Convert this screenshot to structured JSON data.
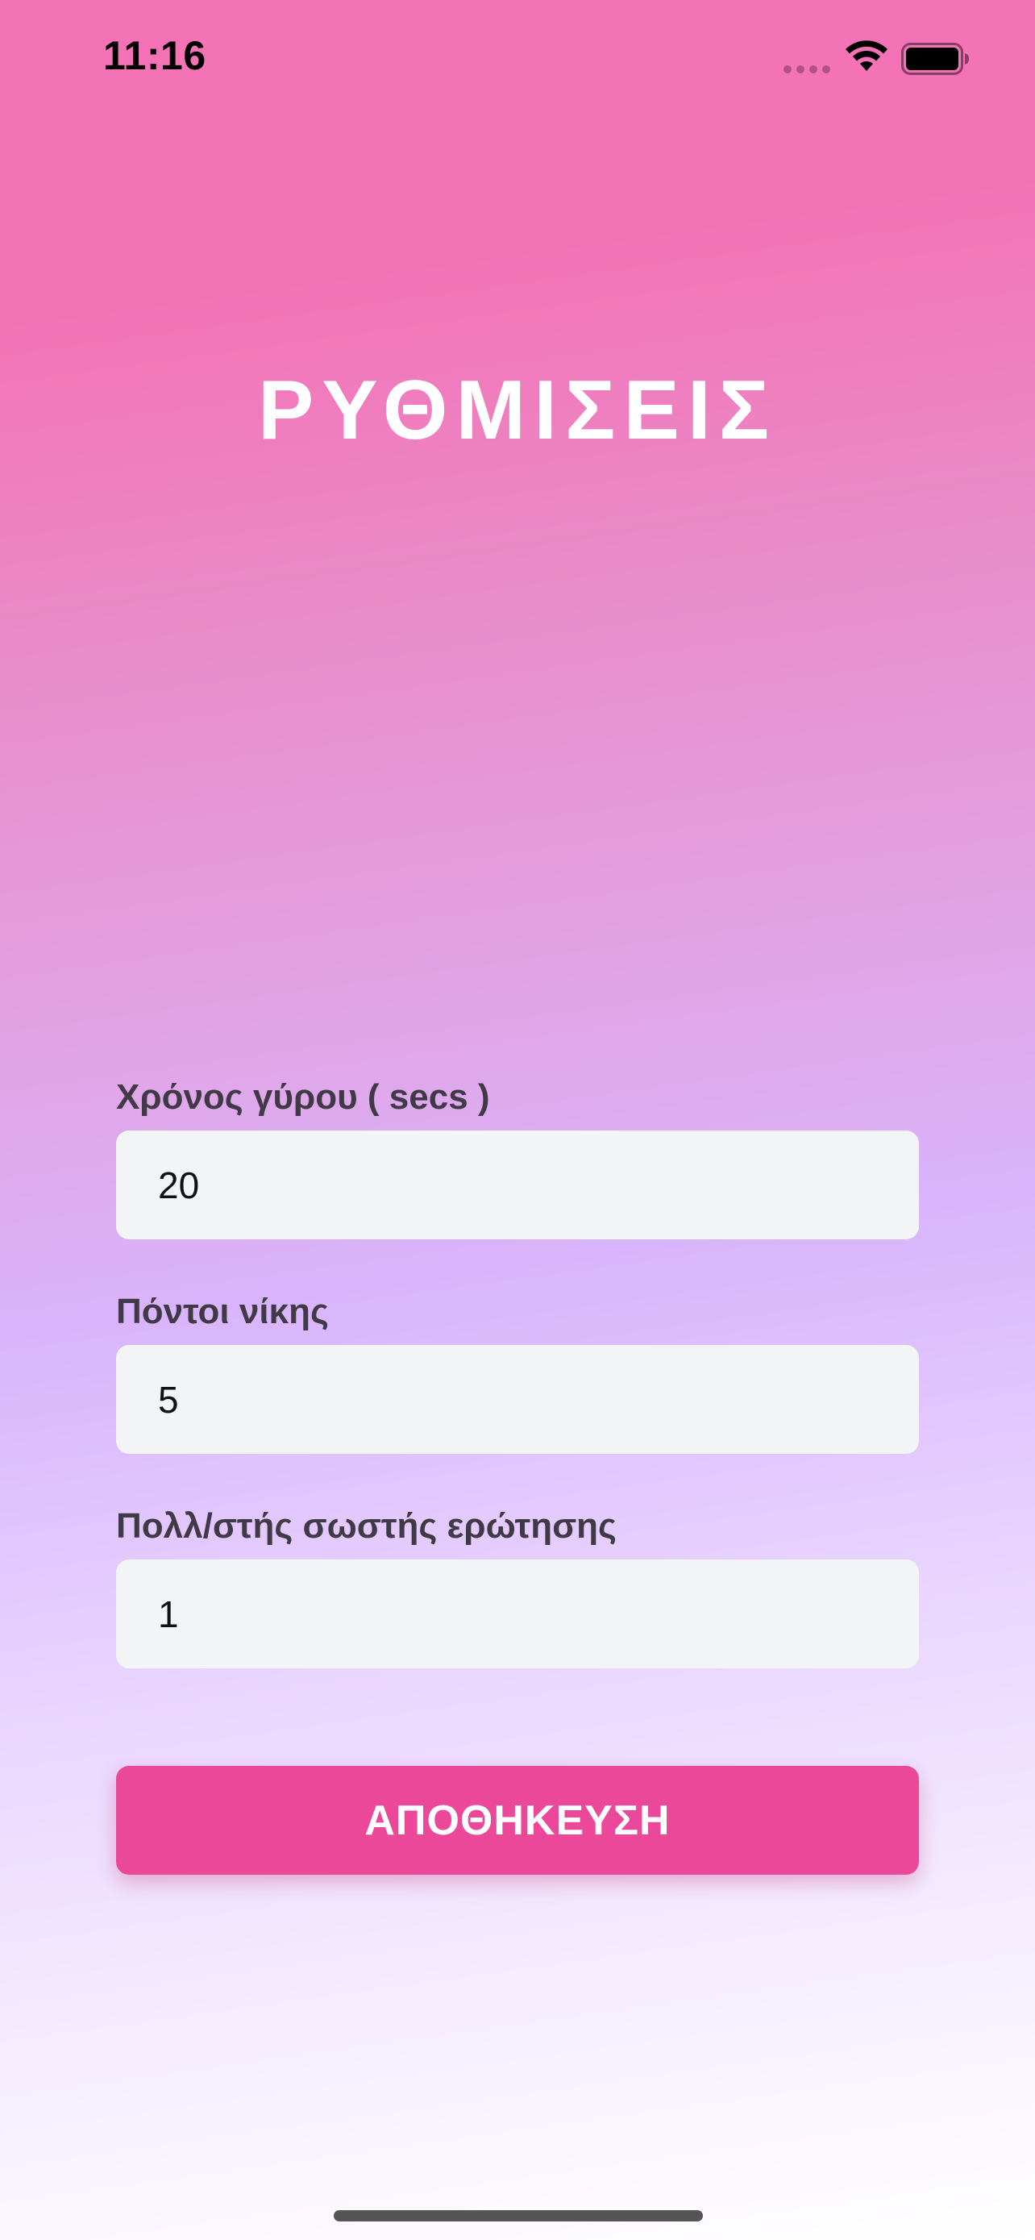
{
  "status_bar": {
    "time": "11:16",
    "icons": [
      "signal-dots-icon",
      "wifi-icon",
      "battery-icon"
    ]
  },
  "title": "ΡΥΘΜΙΣΕΙΣ",
  "form": {
    "round_time": {
      "label": "Χρόνος γύρου ( secs )",
      "value": "20"
    },
    "win_points": {
      "label": "Πόντοι νίκης",
      "value": "5"
    },
    "correct_multiplier": {
      "label": "Πολλ/στής σωστής ερώτησης",
      "value": "1"
    }
  },
  "save_label": "ΑΠΟΘΗΚΕΥΣΗ",
  "colors": {
    "gradient_top": "#f472b6",
    "gradient_mid": "#d8b4fe",
    "gradient_bottom": "#ffffff",
    "input_bg": "#f3f4f6",
    "button_bg": "#ec4899",
    "title_text": "#ffffff",
    "label_text": "#3f3a45"
  }
}
